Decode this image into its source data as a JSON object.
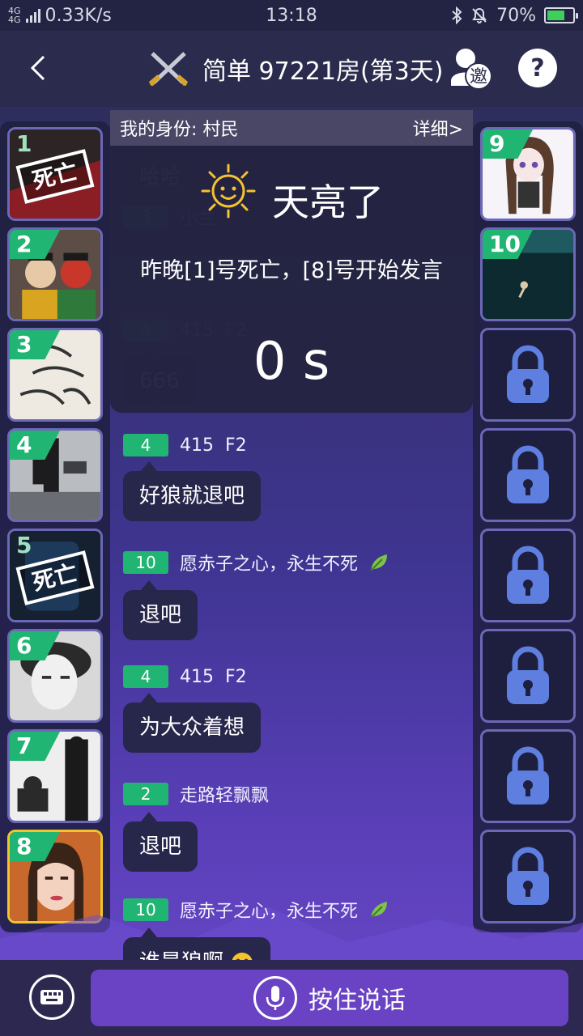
{
  "status_bar": {
    "network": "4G",
    "network2": "4G",
    "speed": "0.33K/s",
    "time": "13:18",
    "battery": "70%",
    "battery_level": 0.7
  },
  "header": {
    "title": "简单 97221房(第3天)",
    "invite_label": "邀",
    "help_label": "?"
  },
  "identity": {
    "role_text": "我的身份: 村民",
    "detail_link": "详细>"
  },
  "players_left": [
    {
      "num": "1",
      "dead": true,
      "stamp": "死亡"
    },
    {
      "num": "2",
      "dead": false
    },
    {
      "num": "3",
      "dead": false
    },
    {
      "num": "4",
      "dead": false
    },
    {
      "num": "5",
      "dead": true,
      "stamp": "死亡"
    },
    {
      "num": "6",
      "dead": false
    },
    {
      "num": "7",
      "dead": false
    },
    {
      "num": "8",
      "dead": false,
      "self": true
    }
  ],
  "players_right": [
    {
      "num": "9"
    },
    {
      "num": "10"
    }
  ],
  "day_notice": {
    "title": "天亮了",
    "message": "昨晚[1]号死亡，[8]号开始发言",
    "countdown": "0 s"
  },
  "faded_chat": [
    {
      "text": "哈哈"
    },
    {
      "seat": "3",
      "name": "小兰"
    },
    {
      "seat": "4",
      "name": "415",
      "tag": "F2",
      "text": "666"
    }
  ],
  "messages": [
    {
      "seat": "4",
      "name": "415",
      "tag": "F2",
      "text": "好狼就退吧"
    },
    {
      "seat": "10",
      "name": "愿赤子之心，永生不死",
      "text": "退吧"
    },
    {
      "seat": "4",
      "name": "415",
      "tag": "F2",
      "text": "为大众着想"
    },
    {
      "seat": "2",
      "name": "走路轻飘飘",
      "text": "退吧"
    },
    {
      "seat": "10",
      "name": "愿赤子之心，永生不死",
      "text": "谁是狼啊"
    }
  ],
  "bottom": {
    "talk_label": "按住说话"
  },
  "colors": {
    "seat_green": "#21b573",
    "self_border": "#f2c42e",
    "talk_button": "#6a43c4"
  }
}
